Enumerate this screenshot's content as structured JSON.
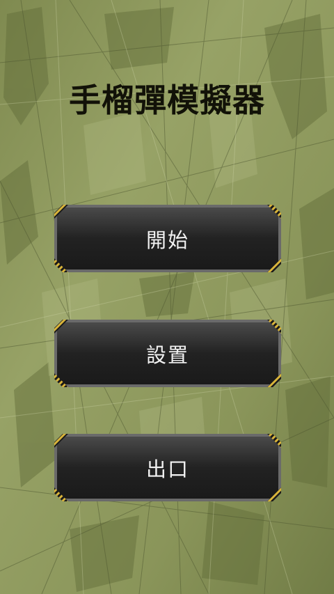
{
  "app": {
    "title": "手榴彈模擬器"
  },
  "menu": {
    "start_label": "開始",
    "settings_label": "設置",
    "exit_label": "出口"
  },
  "colors": {
    "background": "#8f9a5f",
    "title_text": "#121208",
    "button_fill": "#2c2c2c",
    "button_text": "#f2f2f2",
    "hazard_yellow": "#d9b43a"
  }
}
